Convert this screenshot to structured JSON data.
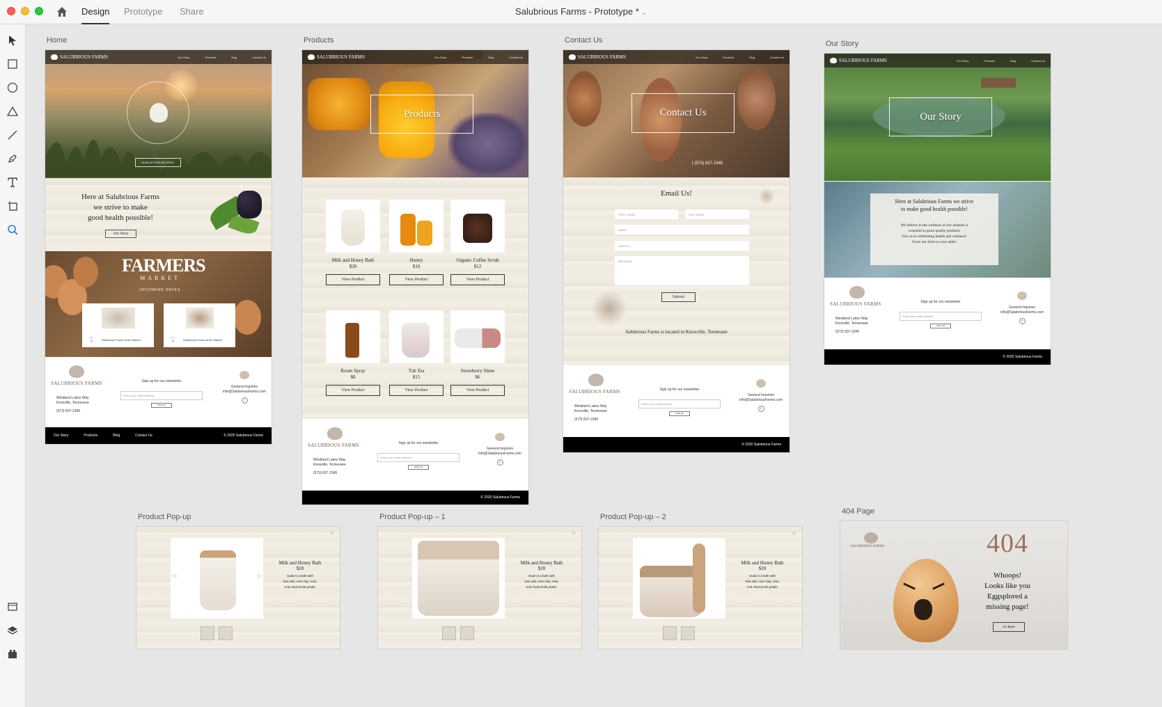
{
  "window": {
    "tabs": [
      {
        "label": "Design",
        "active": true
      },
      {
        "label": "Prototype",
        "active": false
      },
      {
        "label": "Share",
        "active": false
      }
    ],
    "doc_title": "Salubrious Farms - Prototype *"
  },
  "toolbar": {
    "tools": [
      "select-tool",
      "rectangle-tool",
      "ellipse-tool",
      "triangle-tool",
      "line-tool",
      "pen-tool",
      "text-tool",
      "artboard-tool",
      "zoom-tool"
    ],
    "bottom": [
      "assets-panel",
      "layers-panel",
      "plugins-panel"
    ]
  },
  "nav": {
    "brand": "SALUBRIOUS FARMS",
    "links": [
      "Our Story",
      "Products",
      "Blog",
      "Contact Us"
    ]
  },
  "footer": {
    "brand": "SALUBRIOUS FARMS",
    "address1": "Westland Lakes Way",
    "address2": "Knoxville, Tennessee",
    "phone": "(573) 837-2345",
    "newsletter": "Sign up for our newsletter",
    "email_placeholder": "Enter your email address",
    "signup": "SIGN UP",
    "inquiries": "General Inquiries",
    "inquiries_email": "info@SalubriousFarms.com",
    "fb": "f",
    "copyright": "© 2020 Salubrious Farms",
    "links": [
      "Our Story",
      "Products",
      "Blog",
      "Contact Us"
    ]
  },
  "artboards": {
    "home": {
      "label": "Home",
      "hero_cta": "SIGN UP FOR DELIVERY",
      "intro": [
        "Here at Salubrious Farms",
        "we strive to make",
        "good health possible!"
      ],
      "intro_btn": "Our Story",
      "market_title": "FARMERS",
      "market_sub": "MARKET",
      "upcoming": "UPCOMING DATES",
      "events": [
        {
          "month": "JAN",
          "day": "9",
          "text": "Salubrious Farms at the Market"
        },
        {
          "month": "OCT",
          "day": "3",
          "text": "Salubrious Farms at the Market"
        }
      ]
    },
    "products": {
      "label": "Products",
      "hero": "Products",
      "items": [
        {
          "name": "Milk and Honey Bath",
          "price": "$20"
        },
        {
          "name": "Honey",
          "price": "$10"
        },
        {
          "name": "Organic Coffee Scrub",
          "price": "$12"
        },
        {
          "name": "Room Spray",
          "price": "$8"
        },
        {
          "name": "Tub Tea",
          "price": "$15"
        },
        {
          "name": "Strawberry Shine",
          "price": "$6"
        }
      ],
      "button": "View Product"
    },
    "contact": {
      "label": "Contact Us",
      "hero": "Contact Us",
      "hero_info": "| (573) 837-2345",
      "form_title": "Email Us!",
      "first": "FIRST NAME",
      "last": "LAST NAME",
      "email": "EMAIL",
      "subject": "SUBJECT",
      "message": "MESSAGE",
      "submit": "Submit",
      "location": "Salubrious Farms is located in Knoxville, Tennessee"
    },
    "story": {
      "label": "Our Story",
      "hero": "Our Story",
      "heading": [
        "Here at Salubrious Farms we strive",
        "to make good health possible!"
      ],
      "body": [
        "We believe in the wellness of our animals is",
        "essential to good quality products",
        "Join us in celebrating health and wellness!",
        "From our farm to your table!"
      ]
    },
    "popups": [
      {
        "label": "Product Pop-up"
      },
      {
        "label": "Product Pop-up – 1"
      },
      {
        "label": "Product Pop-up – 2"
      }
    ],
    "popup_text": {
      "name": "Milk and Honey Bath",
      "price": "$20",
      "d1": "Soak in a bath with",
      "d2": "Sea salt, rose clay, rose,",
      "d3": "And chamomile petals.",
      "close": "×"
    },
    "notfound": {
      "label": "404 Page",
      "code": "404",
      "msg": [
        "Whoops!",
        "Looks like you",
        "Eggsplored a",
        "missing page!"
      ],
      "btn": "Go Back"
    }
  },
  "colors": {
    "accent": "#2d7cd6",
    "wood": "#f2eee5",
    "brown": "#6e5a48",
    "footer_black": "#000000"
  }
}
